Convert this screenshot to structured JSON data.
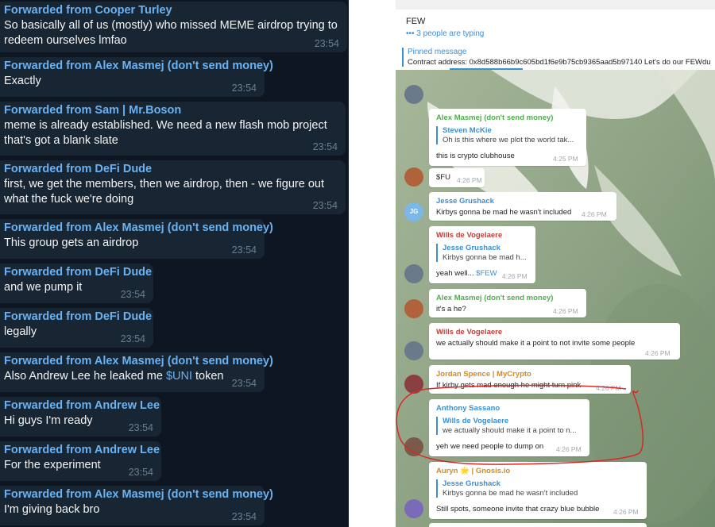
{
  "left_chat": {
    "messages": [
      {
        "from": "Forwarded from Cooper Turley",
        "lines": [
          "So basically all of us (mostly) who missed MEME airdrop trying to",
          "redeem ourselves lmfao"
        ],
        "time": "23:54"
      },
      {
        "from": "Forwarded from Alex Masmej (don't send money)",
        "lines": [
          "Exactly"
        ],
        "time": "23:54"
      },
      {
        "from": "Forwarded from Sam | Mr.Boson",
        "lines": [
          "meme is already established. We need a new flash mob project",
          "that's got a blank slate"
        ],
        "time": "23:54"
      },
      {
        "from": "Forwarded from DeFi Dude",
        "lines": [
          "first, we get the members, then we airdrop, then - we figure out",
          "what the fuck we're doing"
        ],
        "time": "23:54"
      },
      {
        "from": "Forwarded from Alex Masmej (don't send money)",
        "lines": [
          "This group gets an airdrop"
        ],
        "time": "23:54"
      },
      {
        "from": "Forwarded from DeFi Dude",
        "lines": [
          "and we pump it"
        ],
        "time": "23:54"
      },
      {
        "from": "Forwarded from DeFi Dude",
        "lines": [
          "legally"
        ],
        "time": "23:54"
      },
      {
        "from": "Forwarded from Alex Masmej (don't send money)",
        "line_pre": "Also Andrew Lee he leaked me ",
        "line_link": "$UNI",
        "line_post": " token",
        "time": "23:54"
      },
      {
        "from": "Forwarded from Andrew Lee",
        "lines": [
          "Hi guys I'm ready"
        ],
        "time": "23:54"
      },
      {
        "from": "Forwarded from Andrew Lee",
        "lines": [
          "For the experiment"
        ],
        "time": "23:54"
      },
      {
        "from": "Forwarded from Alex Masmej (don't send money)",
        "lines": [
          "I'm giving back bro"
        ],
        "time": "23:54"
      }
    ]
  },
  "right_chat": {
    "header": {
      "title": "FEW",
      "typing": "••• 3 people are typing"
    },
    "pinned": {
      "label": "Pinned message",
      "text": "Contract address: 0x8d588b66b9c605bd1f6e9b75cb9365aad5b97140  Let's do our FEWdu"
    },
    "messages": [
      {
        "name": "Alex Masmej (don't send money)",
        "reply_name": "Steven McKie",
        "reply_text": "Oh is this where we plot the world tak...",
        "text": "this is crypto clubhouse",
        "time": "4:25 PM"
      },
      {
        "text": "$FU",
        "time": "4:26 PM"
      },
      {
        "name": "Jesse Grushack",
        "text": "Kirbys gonna be mad he wasn't included",
        "time": "4:26 PM",
        "avatar": "JG"
      },
      {
        "name": "Wills de Vogelaere",
        "reply_name": "Jesse Grushack",
        "reply_text": "Kirbys gonna be mad h...",
        "text_pre": "yeah well... ",
        "text_link": "$FEW",
        "time": "4:26 PM"
      },
      {
        "name": "Alex Masmej (don't send money)",
        "text": "it's a he?",
        "time": "4:26 PM"
      },
      {
        "name": "Wills de Vogelaere",
        "text": "we actually should make it a point to not invite some people",
        "time": "4:26 PM"
      },
      {
        "name": "Jordan Spence | MyCrypto",
        "text": "If kirby gets mad enough he might turn pink",
        "time": "4:26 PM"
      },
      {
        "name": "Anthony Sassano",
        "reply_name": "Wills de Vogelaere",
        "reply_text": "we actually should make it a point to n...",
        "text": "yeh we need people to dump on",
        "time": "4:26 PM"
      },
      {
        "name": "Auryn 🌟 | Gnosis.io",
        "reply_name": "Jesse Grushack",
        "reply_text": "Kirbys gonna be mad he wasn't included",
        "text": "Still spots, someone invite that crazy blue bubble",
        "time": "4:26 PM"
      }
    ]
  },
  "colors": {
    "dark_bg": "#0e1621",
    "dark_bubble": "#182533",
    "sender_blue": "#6ab2f2",
    "annotation_red": "#d42a2a"
  }
}
